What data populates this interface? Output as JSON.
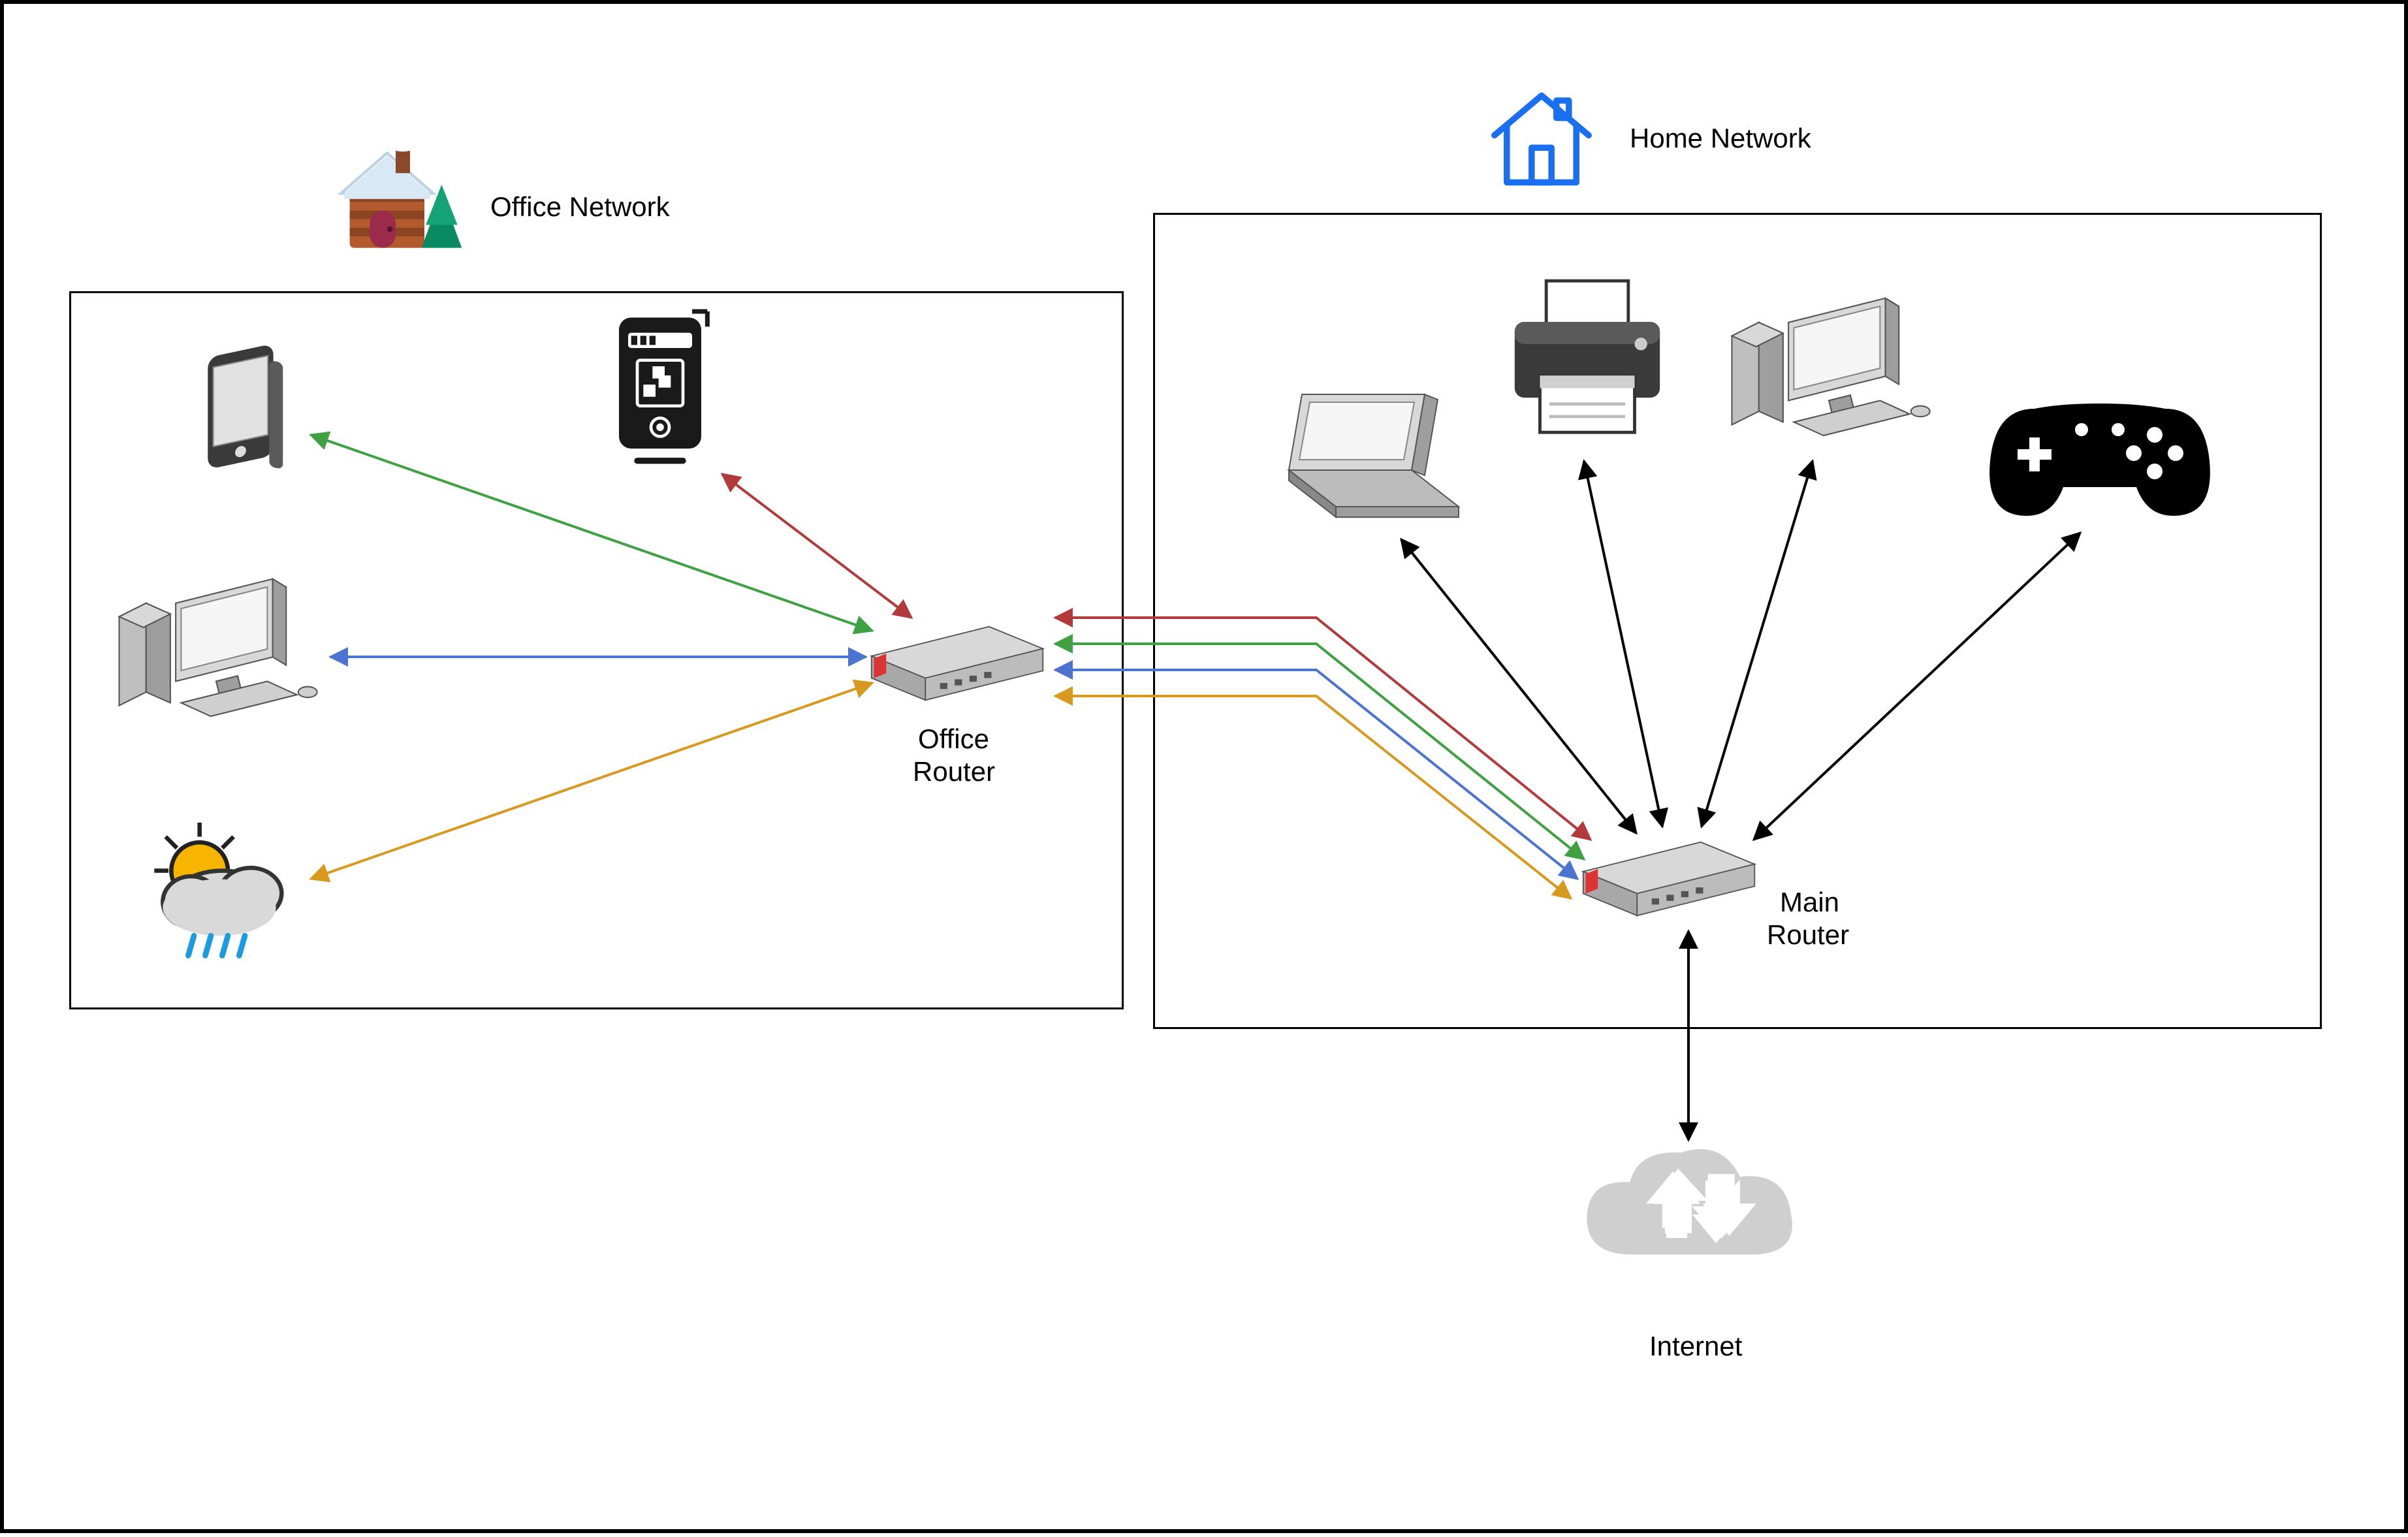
{
  "labels": {
    "office_network": "Office Network",
    "home_network": "Home Network",
    "office_router_line1": "Office",
    "office_router_line2": "Router",
    "main_router_line1": "Main",
    "main_router_line2": "Router",
    "internet": "Internet"
  },
  "colors": {
    "green": "#3fa142",
    "red": "#b23a3a",
    "blue": "#4a74d0",
    "yellow": "#d79a1f",
    "black": "#000000"
  },
  "nodes": {
    "office": {
      "phone": "smartphone-icon",
      "tablet": "tablet-icon",
      "desktop": "desktop-icon",
      "weather": "weather-icon",
      "router": "office-router-icon"
    },
    "home": {
      "laptop": "laptop-icon",
      "printer": "printer-icon",
      "desktop": "desktop-icon",
      "gamepad": "gamepad-icon",
      "router": "main-router-icon"
    },
    "cloud": "internet-cloud-icon"
  }
}
